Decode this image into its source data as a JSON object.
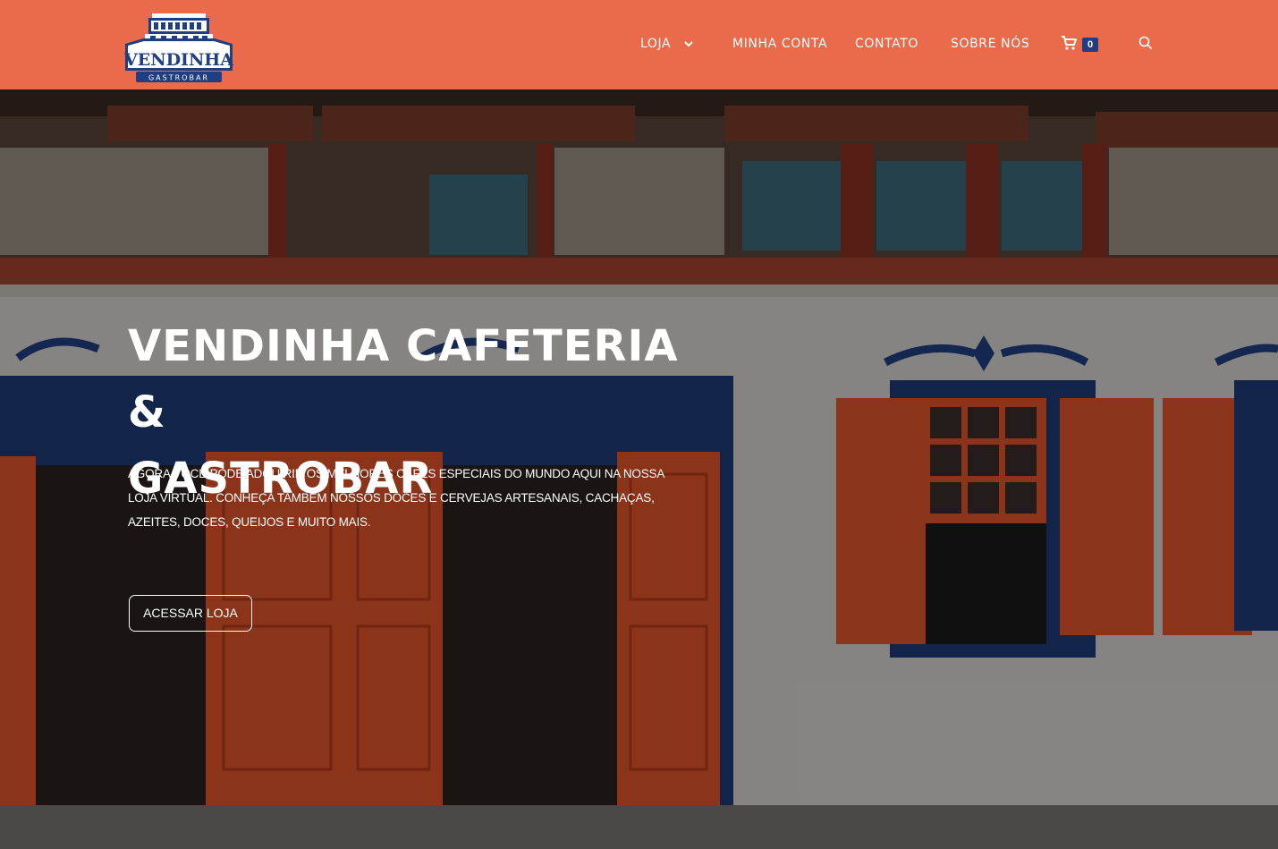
{
  "brand": {
    "logo_name": "VENDINHA",
    "logo_tagline": "GASTROBAR",
    "header_color": "#ea6a4c",
    "accent_blue": "#1f3f82"
  },
  "nav": {
    "items": [
      {
        "label": "LOJA",
        "has_dropdown": true
      },
      {
        "label": "MINHA CONTA"
      },
      {
        "label": "CONTATO"
      },
      {
        "label": "SOBRE NÓS"
      }
    ],
    "cart_count": "0",
    "cart_icon": "cart-icon",
    "search_icon": "search-icon"
  },
  "hero": {
    "title_line1": "VENDINHA CAFETERIA &",
    "title_line2": "GASTROBAR",
    "description": "AGORA VOCÊ PODE ADQUIRIR OS MELHORES CAFÉS ESPECIAIS DO MUNDO AQUI NA NOSSA LOJA VIRTUAL. CONHEÇA TAMBÉM NOSSOS DOCES E CERVEJAS ARTESANAIS, CACHAÇAS, AZEITES, DOCES, QUEIJOS E MUITO MAIS.",
    "cta_label": "ACESSAR LOJA"
  }
}
